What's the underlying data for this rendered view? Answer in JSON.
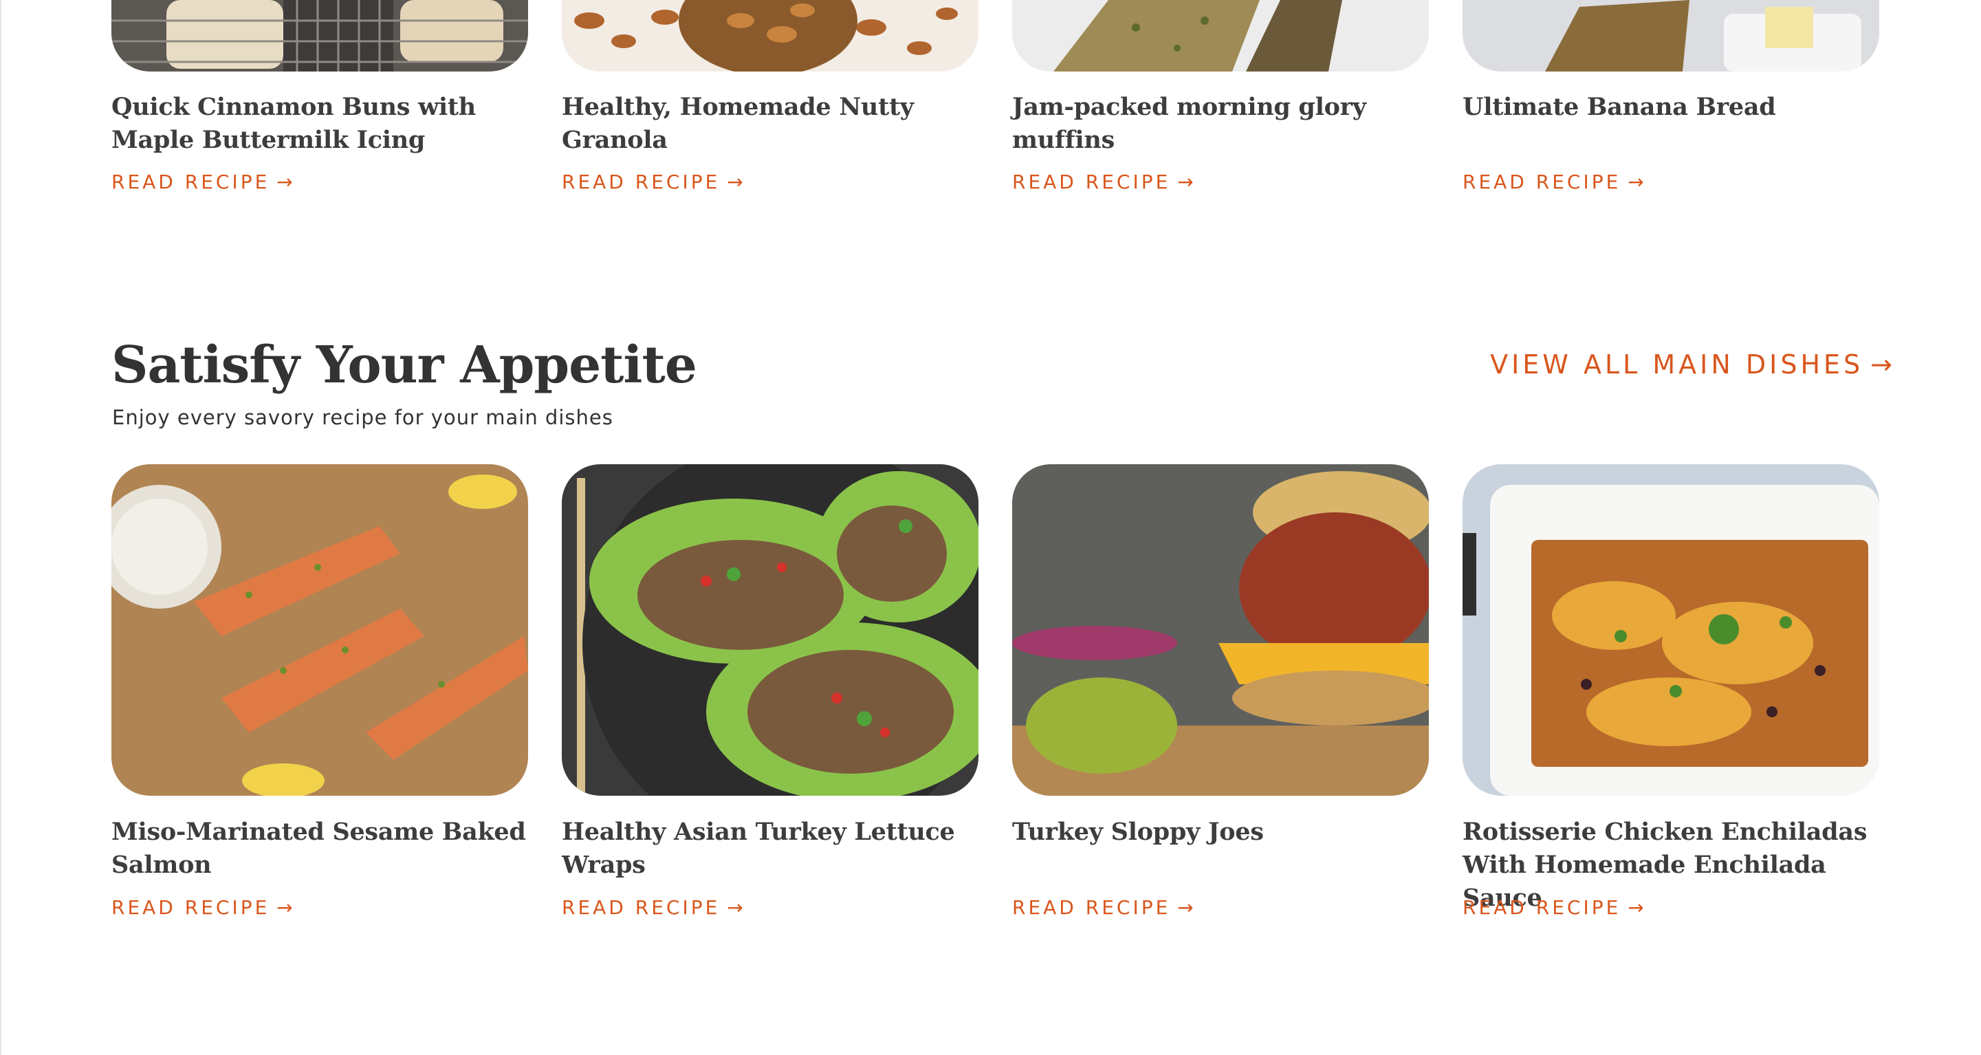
{
  "top_row": [
    {
      "title": "Quick Cinnamon Buns with Maple Buttermilk Icing",
      "cta": "READ RECIPE",
      "image": "cinnamon-buns-photo"
    },
    {
      "title": "Healthy, Homemade Nutty Granola",
      "cta": "READ RECIPE",
      "image": "granola-photo"
    },
    {
      "title": "Jam-packed morning glory muffins",
      "cta": "READ RECIPE",
      "image": "muffins-photo"
    },
    {
      "title": "Ultimate Banana Bread",
      "cta": "READ RECIPE",
      "image": "banana-bread-photo"
    }
  ],
  "section": {
    "title": "Satisfy Your Appetite",
    "subtitle": "Enjoy every savory recipe  for your main dishes",
    "view_all": "VIEW ALL MAIN DISHES"
  },
  "main_dishes": [
    {
      "title": "Miso-Marinated Sesame Baked Salmon",
      "cta": "READ RECIPE",
      "image": "salmon-photo"
    },
    {
      "title": "Healthy Asian Turkey Lettuce Wraps",
      "cta": "READ RECIPE",
      "image": "lettuce-wraps-photo"
    },
    {
      "title": "Turkey Sloppy Joes",
      "cta": "READ RECIPE",
      "image": "sloppy-joe-photo"
    },
    {
      "title": "Rotisserie Chicken Enchiladas With Homemade Enchilada Sauce",
      "cta": "READ RECIPE",
      "image": "enchiladas-photo"
    }
  ],
  "colors": {
    "accent": "#d9561c",
    "heading": "#333333"
  },
  "icons": {
    "cta_arrow": "arrow-right-icon"
  }
}
